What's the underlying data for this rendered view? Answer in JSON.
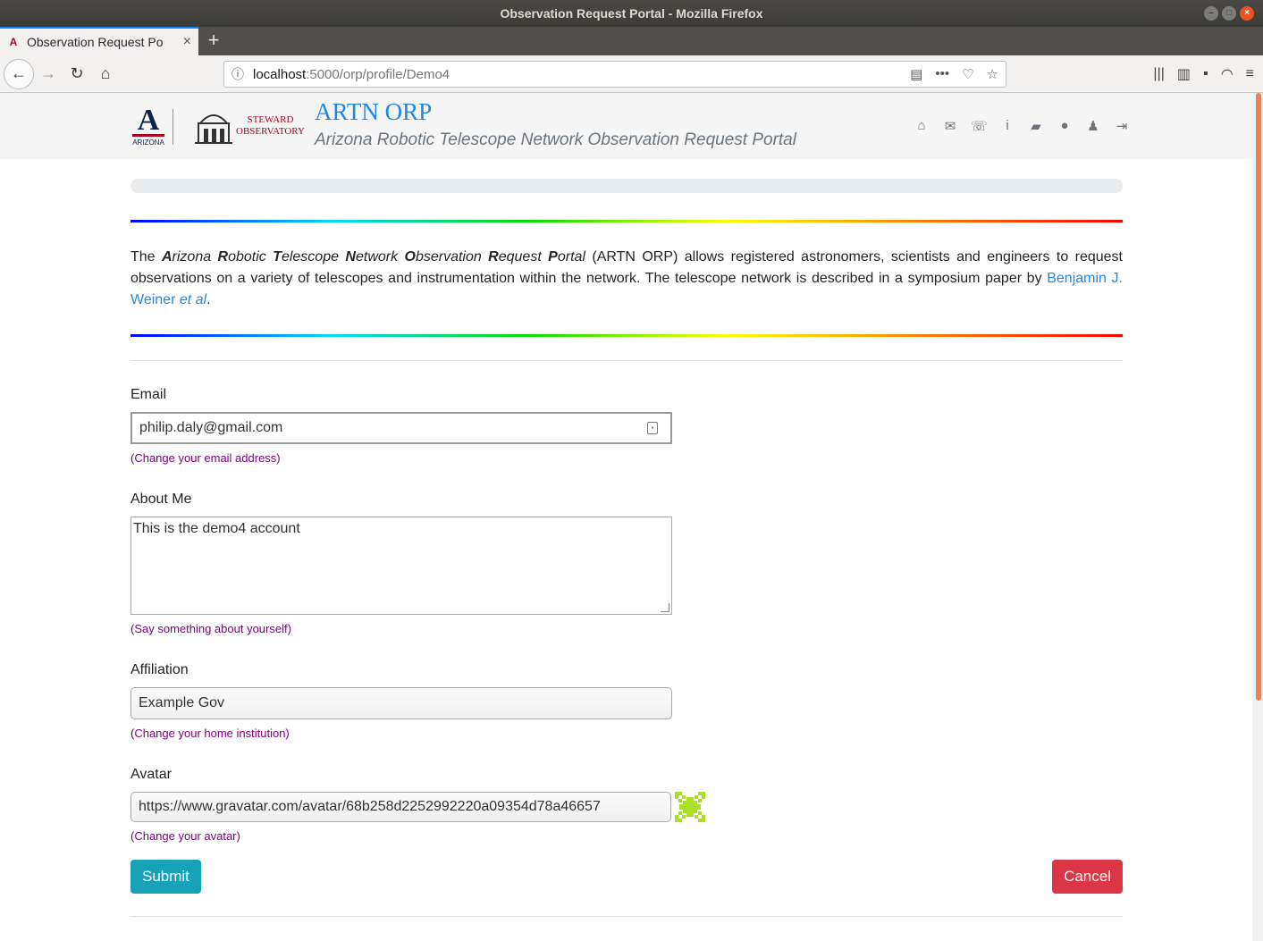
{
  "window": {
    "title": "Observation Request Portal - Mozilla Firefox"
  },
  "tab": {
    "title": "Observation Request Po"
  },
  "url": {
    "host": "localhost",
    "path": ":5000/orp/profile/Demo4"
  },
  "header": {
    "university_caption": "ARIZONA",
    "steward_line1": "STEWARD",
    "steward_line2": "OBSERVATORY",
    "title": "ARTN ORP",
    "subtitle": "Arizona Robotic Telescope Network Observation Request Portal",
    "nav_icons": [
      "home-icon",
      "envelope-icon",
      "phone-icon",
      "info-icon",
      "book-icon",
      "comments-icon",
      "user-icon",
      "sign-out-icon"
    ]
  },
  "intro": {
    "the": "The ",
    "w1_b": "A",
    "w1_r": "rizona ",
    "w2_b": "R",
    "w2_r": "obotic ",
    "w3_b": "T",
    "w3_r": "elescope ",
    "w4_b": "N",
    "w4_r": "etwork ",
    "w5_b": "O",
    "w5_r": "bservation ",
    "w6_b": "R",
    "w6_r": "equest ",
    "w7_b": "P",
    "w7_r": "ortal",
    "body": " (ARTN ORP) allows registered astronomers, scientists and engineers to request observations on a variety of telescopes and instrumentation within the network. The telescope network is described in a symposium paper by ",
    "link": "Benjamin J. Weiner ",
    "link_etal": "et al",
    "end": "."
  },
  "form": {
    "email_label": "Email",
    "email_value": "philip.daly@gmail.com",
    "email_help": "(Change your email address)",
    "about_label": "About Me",
    "about_value": "This is the demo4 account",
    "about_help": "(Say something about yourself)",
    "affiliation_label": "Affiliation",
    "affiliation_value": "Example Gov",
    "affiliation_help": "(Change your home institution)",
    "avatar_label": "Avatar",
    "avatar_value": "https://www.gravatar.com/avatar/68b258d2252992220a09354d78a46657",
    "avatar_help": "(Change your avatar)",
    "submit": "Submit",
    "cancel": "Cancel"
  },
  "colors": {
    "submit": "#17a2b8",
    "cancel": "#dc3545",
    "link": "#1e88e5",
    "help": "#800080",
    "avatar": "#a8e028"
  }
}
